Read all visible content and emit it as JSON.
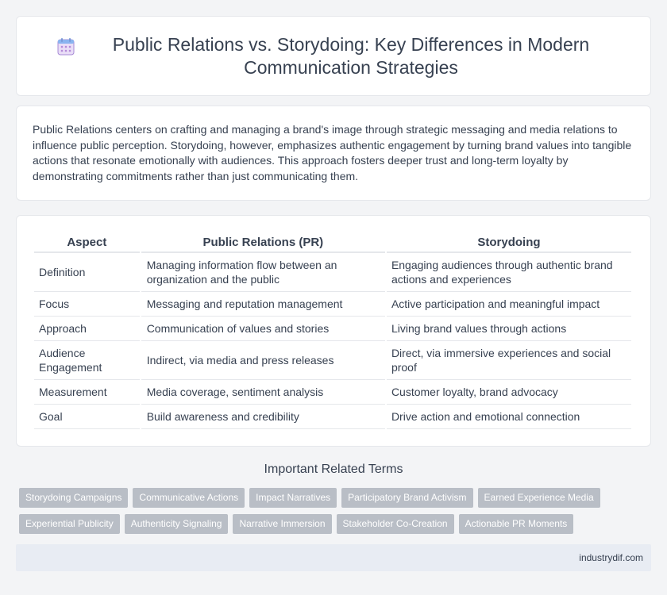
{
  "header": {
    "title": "Public Relations vs. Storydoing: Key Differences in Modern Communication Strategies",
    "icon": "calendar-icon"
  },
  "intro": {
    "text": "Public Relations centers on crafting and managing a brand's image through strategic messaging and media relations to influence public perception. Storydoing, however, emphasizes authentic engagement by turning brand values into tangible actions that resonate emotionally with audiences. This approach fosters deeper trust and long-term loyalty by demonstrating commitments rather than just communicating them."
  },
  "table": {
    "headers": [
      "Aspect",
      "Public Relations (PR)",
      "Storydoing"
    ],
    "rows": [
      [
        "Definition",
        "Managing information flow between an organization and the public",
        "Engaging audiences through authentic brand actions and experiences"
      ],
      [
        "Focus",
        "Messaging and reputation management",
        "Active participation and meaningful impact"
      ],
      [
        "Approach",
        "Communication of values and stories",
        "Living brand values through actions"
      ],
      [
        "Audience Engagement",
        "Indirect, via media and press releases",
        "Direct, via immersive experiences and social proof"
      ],
      [
        "Measurement",
        "Media coverage, sentiment analysis",
        "Customer loyalty, brand advocacy"
      ],
      [
        "Goal",
        "Build awareness and credibility",
        "Drive action and emotional connection"
      ]
    ]
  },
  "related": {
    "title": "Important Related Terms",
    "tags_row1": [
      "Storydoing Campaigns",
      "Communicative Actions",
      "Impact Narratives",
      "Participatory Brand Activism",
      "Earned Experience Media"
    ],
    "tags_row2": [
      "Experiential Publicity",
      "Authenticity Signaling",
      "Narrative Immersion",
      "Stakeholder Co-Creation",
      "Actionable PR Moments"
    ]
  },
  "footer": {
    "site": "industrydif.com"
  },
  "colors": {
    "background": "#f3f4f6",
    "card": "#ffffff",
    "tag": "#b9bec6",
    "footer": "#e8ecf3"
  }
}
